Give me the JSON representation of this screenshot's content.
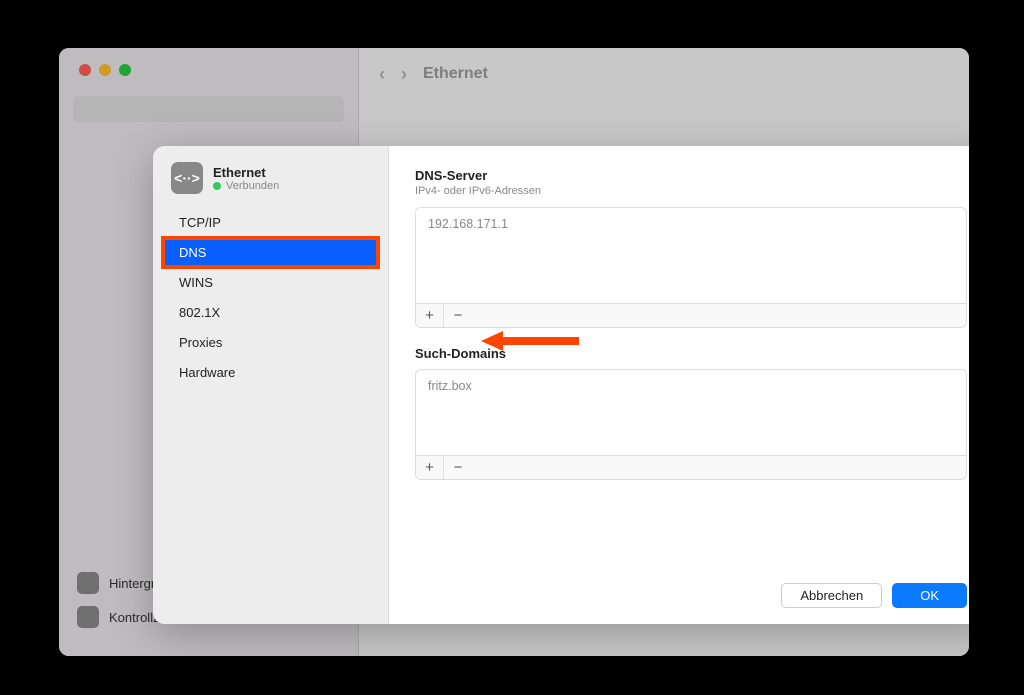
{
  "window": {
    "title": "Ethernet",
    "bg_sidebar_items": [
      "Hintergrundbild",
      "Kontrollzentrum"
    ]
  },
  "sheet": {
    "connection": {
      "name": "Ethernet",
      "status": "Verbunden",
      "icon_glyph": "<··>"
    },
    "sidebar": {
      "items": [
        {
          "label": "TCP/IP",
          "selected": false
        },
        {
          "label": "DNS",
          "selected": true,
          "highlighted": true
        },
        {
          "label": "WINS",
          "selected": false
        },
        {
          "label": "802.1X",
          "selected": false
        },
        {
          "label": "Proxies",
          "selected": false
        },
        {
          "label": "Hardware",
          "selected": false
        }
      ]
    },
    "dns_section": {
      "title": "DNS-Server",
      "subtitle": "IPv4- oder IPv6-Adressen",
      "entries": [
        "192.168.171.1"
      ]
    },
    "search_domains": {
      "title": "Such-Domains",
      "entries": [
        "fritz.box"
      ]
    },
    "buttons": {
      "cancel": "Abbrechen",
      "ok": "OK"
    }
  },
  "annotations": {
    "highlight_dns": true,
    "arrow_to_plus_minus": true
  }
}
